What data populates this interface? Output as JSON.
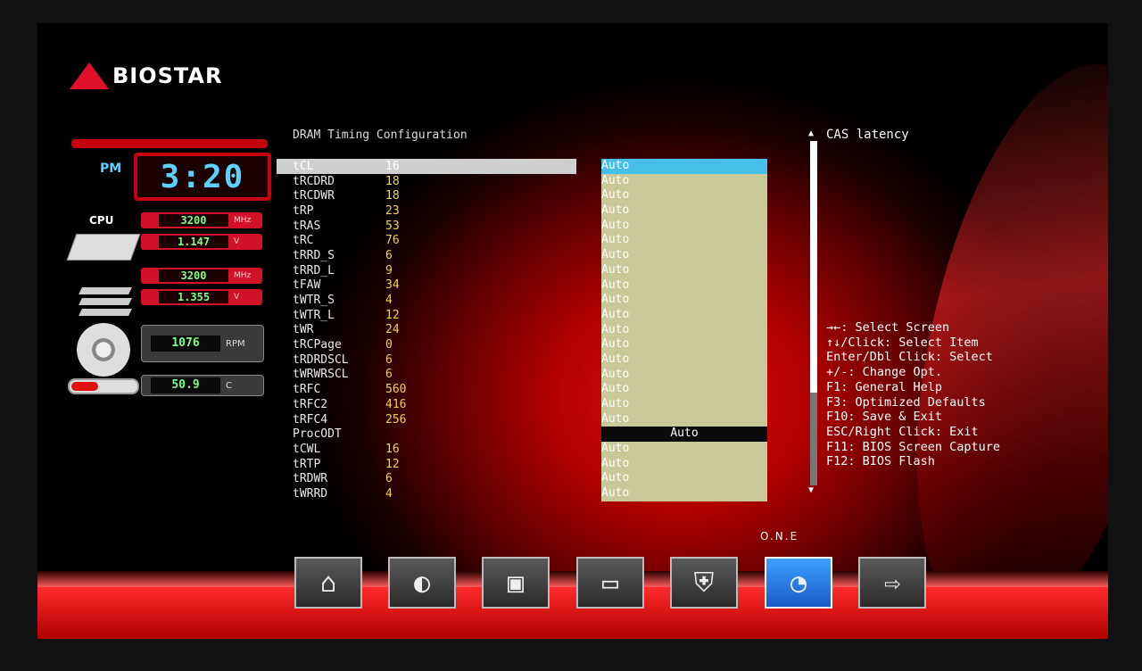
{
  "brand": {
    "name": "BIOSTAR"
  },
  "clock": {
    "ampm": "PM",
    "time": "3:20"
  },
  "monitor": {
    "cpu_label": "CPU",
    "cpu_freq": "3200",
    "cpu_freq_unit": "MHz",
    "cpu_volt": "1.147",
    "cpu_volt_unit": "V",
    "mem_freq": "3200",
    "mem_freq_unit": "MHz",
    "mem_volt": "1.355",
    "mem_volt_unit": "V",
    "fan_rpm": "1076",
    "fan_unit": "RPM",
    "temp": "50.9",
    "temp_unit": "C"
  },
  "section_title": "DRAM Timing Configuration",
  "timings": [
    {
      "name": "tCL",
      "value": "16",
      "option": "Auto"
    },
    {
      "name": "tRCDRD",
      "value": "18",
      "option": "Auto"
    },
    {
      "name": "tRCDWR",
      "value": "18",
      "option": "Auto"
    },
    {
      "name": "tRP",
      "value": "23",
      "option": "Auto"
    },
    {
      "name": "tRAS",
      "value": "53",
      "option": "Auto"
    },
    {
      "name": "tRC",
      "value": "76",
      "option": "Auto"
    },
    {
      "name": "tRRD_S",
      "value": "6",
      "option": "Auto"
    },
    {
      "name": "tRRD_L",
      "value": "9",
      "option": "Auto"
    },
    {
      "name": "tFAW",
      "value": "34",
      "option": "Auto"
    },
    {
      "name": "tWTR_S",
      "value": "4",
      "option": "Auto"
    },
    {
      "name": "tWTR_L",
      "value": "12",
      "option": "Auto"
    },
    {
      "name": "tWR",
      "value": "24",
      "option": "Auto"
    },
    {
      "name": "tRCPage",
      "value": "0",
      "option": "Auto"
    },
    {
      "name": "tRDRDSCL",
      "value": "6",
      "option": "Auto"
    },
    {
      "name": "tWRWRSCL",
      "value": "6",
      "option": "Auto"
    },
    {
      "name": "tRFC",
      "value": "560",
      "option": "Auto"
    },
    {
      "name": "tRFC2",
      "value": "416",
      "option": "Auto"
    },
    {
      "name": "tRFC4",
      "value": "256",
      "option": "Auto"
    },
    {
      "name": "ProcODT",
      "value": "",
      "option": "Auto"
    },
    {
      "name": "tCWL",
      "value": "16",
      "option": "Auto"
    },
    {
      "name": "tRTP",
      "value": "12",
      "option": "Auto"
    },
    {
      "name": "tRDWR",
      "value": "6",
      "option": "Auto"
    },
    {
      "name": "tWRRD",
      "value": "4",
      "option": "Auto"
    }
  ],
  "help": {
    "title": "CAS latency",
    "keys": [
      "→←: Select Screen",
      "↑↓/Click: Select Item",
      "Enter/Dbl Click: Select",
      "+/-: Change Opt.",
      "F1: General Help",
      "F3: Optimized Defaults",
      "F10: Save & Exit",
      "ESC/Right Click: Exit",
      "F11: BIOS Screen Capture",
      "F12: BIOS Flash"
    ]
  },
  "toolbar": {
    "active_label": "O.N.E",
    "items": [
      {
        "icon": "home-icon",
        "glyph": "⌂"
      },
      {
        "icon": "joystick-icon",
        "glyph": "◐"
      },
      {
        "icon": "chip-icon",
        "glyph": "▣"
      },
      {
        "icon": "drive-icon",
        "glyph": "▭"
      },
      {
        "icon": "shield-icon",
        "glyph": "⛨"
      },
      {
        "icon": "speedometer-icon",
        "glyph": "◔"
      },
      {
        "icon": "exit-icon",
        "glyph": "⇨"
      }
    ]
  }
}
